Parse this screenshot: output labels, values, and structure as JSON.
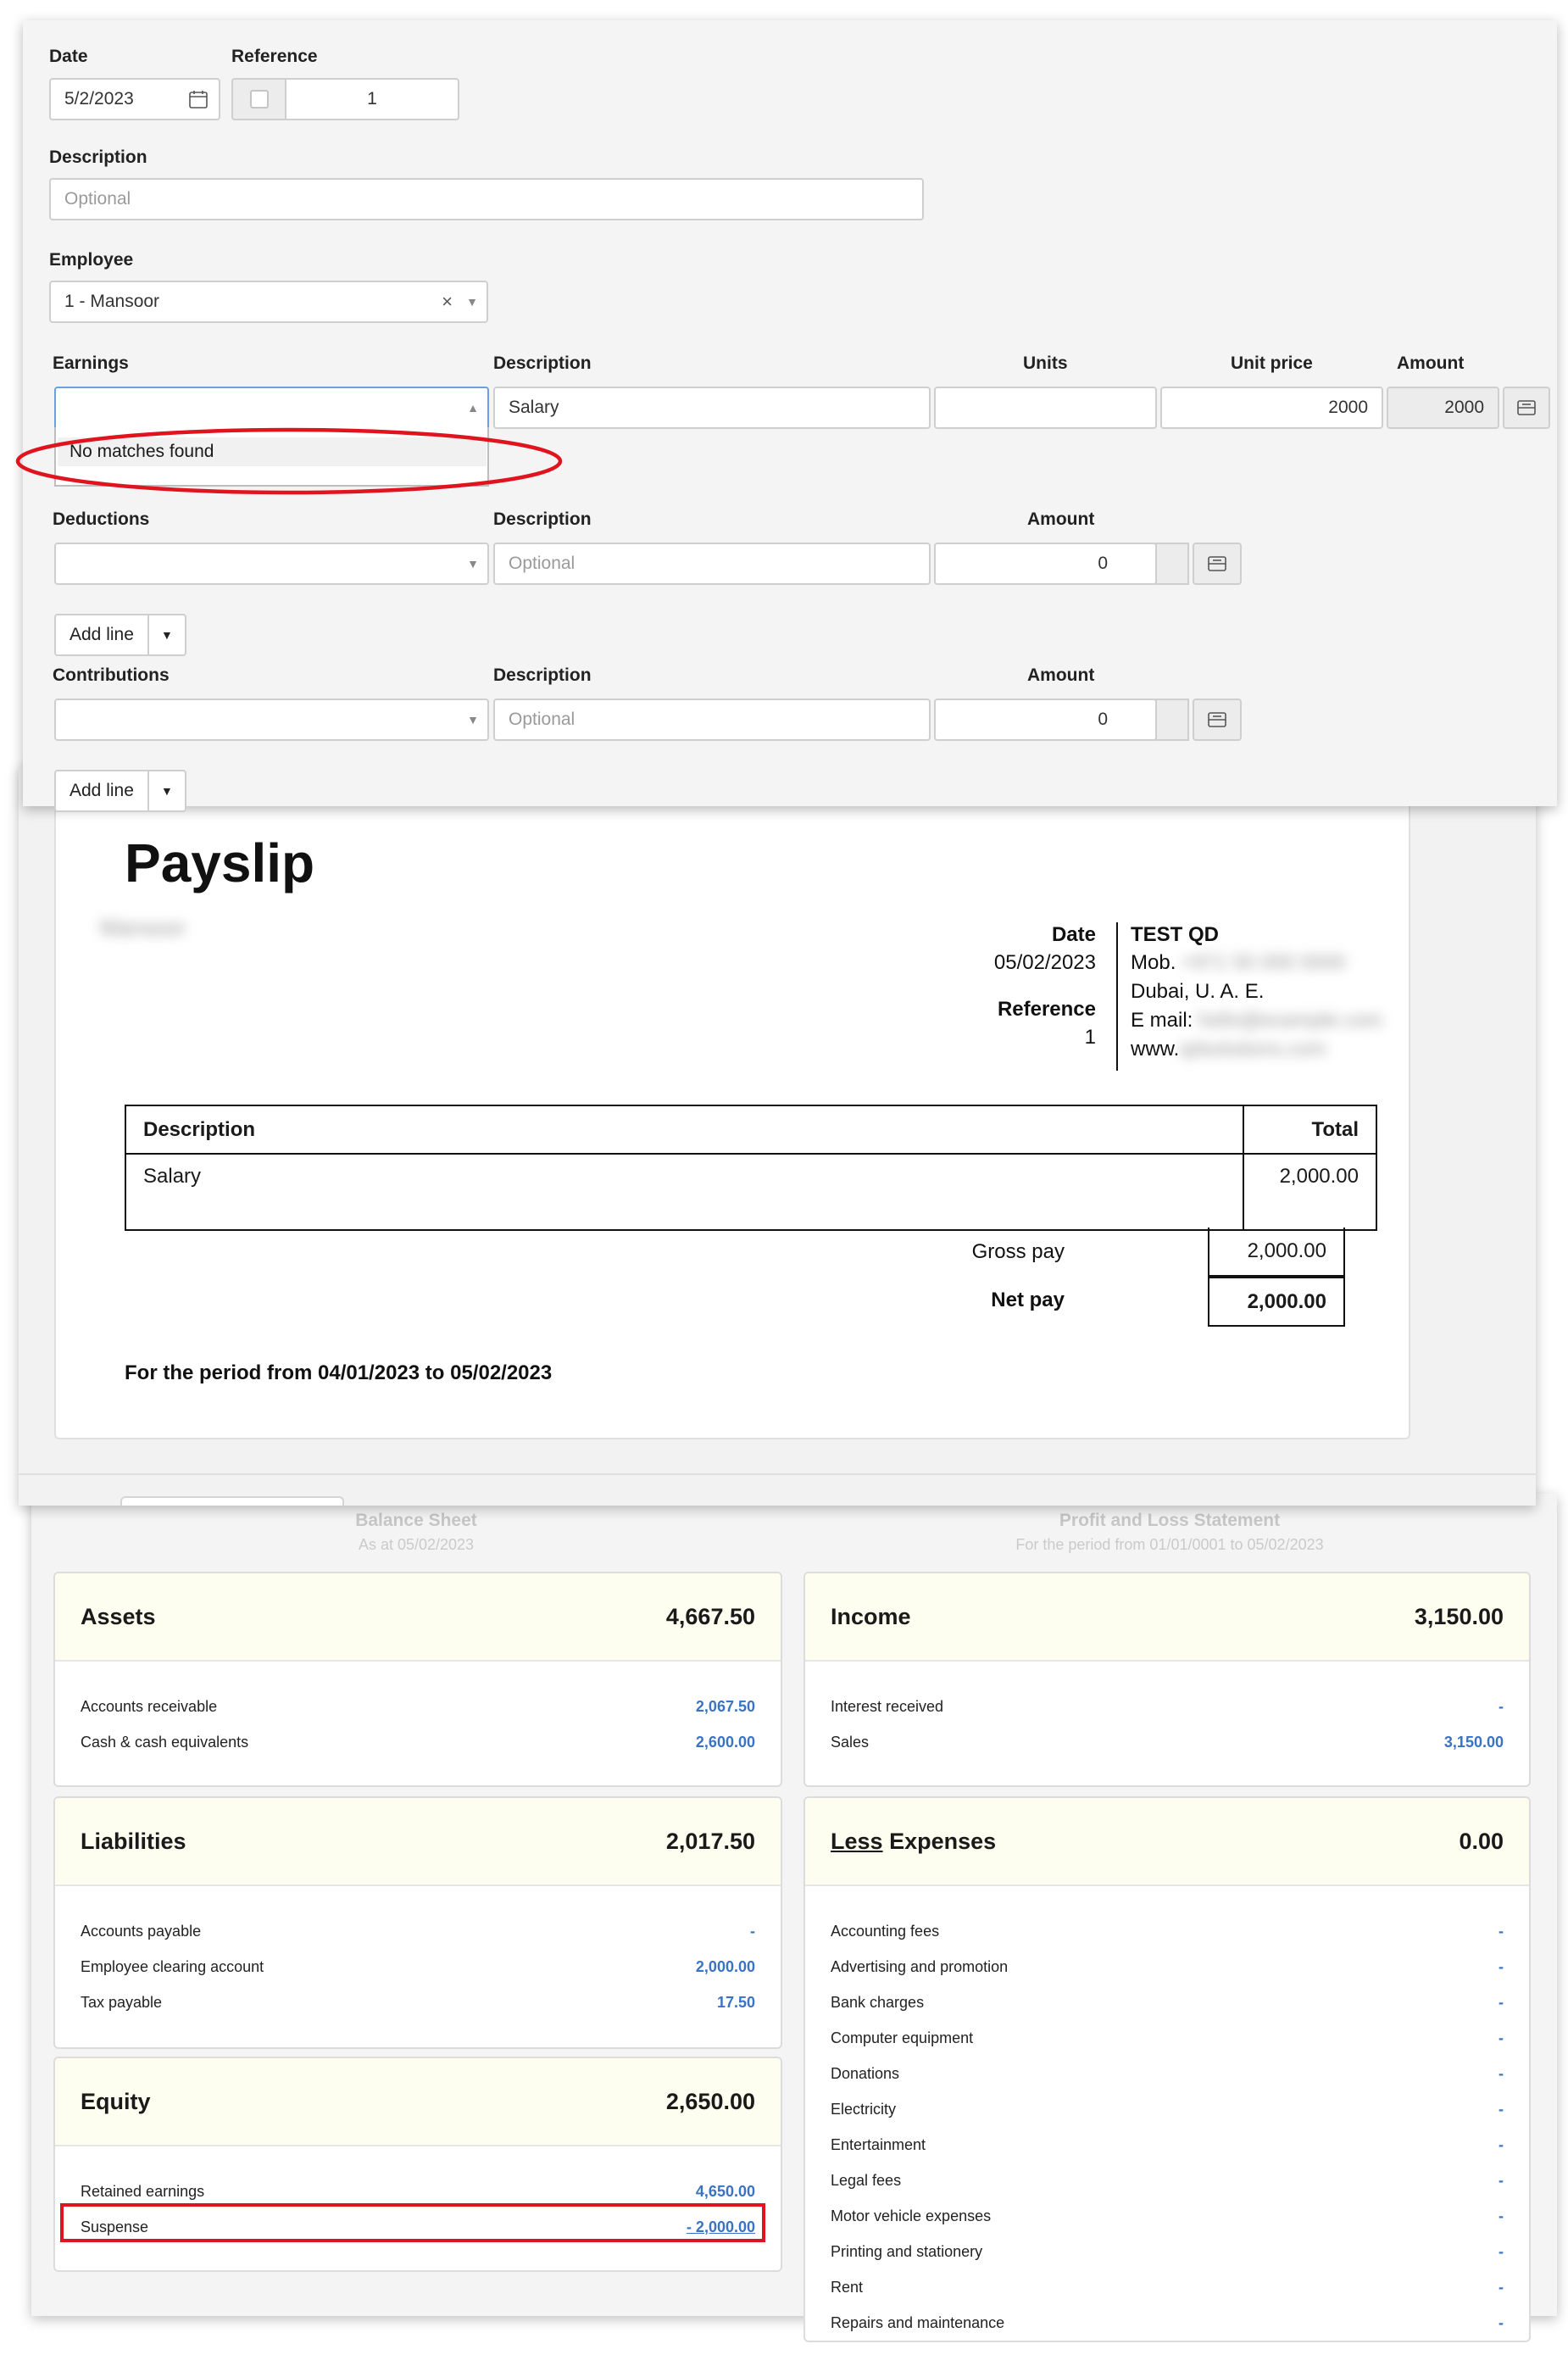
{
  "form": {
    "date_label": "Date",
    "date_value": "5/2/2023",
    "reference_label": "Reference",
    "reference_value": "1",
    "description_label": "Description",
    "description_placeholder": "Optional",
    "employee_label": "Employee",
    "employee_value": "1 - Mansoor",
    "employee_clear": "×",
    "earnings": {
      "header": "Earnings",
      "description_header": "Description",
      "units_header": "Units",
      "unit_price_header": "Unit price",
      "amount_header": "Amount",
      "dropdown_message": "No matches found",
      "description_value": "Salary",
      "unit_price_value": "2000",
      "amount_value": "2000"
    },
    "deductions": {
      "header": "Deductions",
      "description_header": "Description",
      "amount_header": "Amount",
      "description_placeholder": "Optional",
      "amount_value": "0",
      "add_line_label": "Add line"
    },
    "contributions": {
      "header": "Contributions",
      "description_header": "Description",
      "amount_header": "Amount",
      "description_placeholder": "Optional",
      "amount_value": "0",
      "add_line_label": "Add line"
    }
  },
  "payslip": {
    "title": "Payslip",
    "employee_name_blurred": "Mansoor",
    "date_label": "Date",
    "date_value": "05/02/2023",
    "reference_label": "Reference",
    "reference_value": "1",
    "company_name": "TEST QD",
    "company_mob": "Mob.",
    "company_city": "Dubai, U. A. E.",
    "company_email": "E mail:",
    "company_web": "www.",
    "table_header_description": "Description",
    "table_header_total": "Total",
    "line_description": "Salary",
    "line_total": "2,000.00",
    "gross_pay_label": "Gross pay",
    "gross_pay_value": "2,000.00",
    "net_pay_label": "Net pay",
    "net_pay_value": "2,000.00",
    "period_text": "For the period from 04/01/2023 to 05/02/2023"
  },
  "summary": {
    "balance_sheet_title": "Balance Sheet",
    "balance_sheet_sub": "As at 05/02/2023",
    "pl_title": "Profit and Loss Statement",
    "pl_sub": "For the period from 01/01/0001 to 05/02/2023",
    "assets": {
      "title": "Assets",
      "total": "4,667.50",
      "rows": [
        {
          "label": "Accounts receivable",
          "value": "2,067.50"
        },
        {
          "label": "Cash & cash equivalents",
          "value": "2,600.00"
        }
      ]
    },
    "liabilities": {
      "title": "Liabilities",
      "total": "2,017.50",
      "rows": [
        {
          "label": "Accounts payable",
          "value": "-"
        },
        {
          "label": "Employee clearing account",
          "value": "2,000.00"
        },
        {
          "label": "Tax payable",
          "value": "17.50"
        }
      ]
    },
    "equity": {
      "title": "Equity",
      "total": "2,650.00",
      "rows": [
        {
          "label": "Retained earnings",
          "value": "4,650.00"
        },
        {
          "label": "Suspense",
          "value": "- 2,000.00"
        }
      ]
    },
    "income": {
      "title": "Income",
      "total": "3,150.00",
      "rows": [
        {
          "label": "Interest received",
          "value": "-"
        },
        {
          "label": "Sales",
          "value": "3,150.00"
        }
      ]
    },
    "expenses": {
      "title_prefix": "Less",
      "title": "Expenses",
      "total": "0.00",
      "rows": [
        {
          "label": "Accounting fees",
          "value": "-"
        },
        {
          "label": "Advertising and promotion",
          "value": "-"
        },
        {
          "label": "Bank charges",
          "value": "-"
        },
        {
          "label": "Computer equipment",
          "value": "-"
        },
        {
          "label": "Donations",
          "value": "-"
        },
        {
          "label": "Electricity",
          "value": "-"
        },
        {
          "label": "Entertainment",
          "value": "-"
        },
        {
          "label": "Legal fees",
          "value": "-"
        },
        {
          "label": "Motor vehicle expenses",
          "value": "-"
        },
        {
          "label": "Printing and stationery",
          "value": "-"
        },
        {
          "label": "Rent",
          "value": "-"
        },
        {
          "label": "Repairs and maintenance",
          "value": "-"
        }
      ]
    }
  },
  "colors": {
    "highlight_red": "#e0141e",
    "link_blue": "#3a73c4",
    "card_header_bg": "#fdfdf0"
  }
}
